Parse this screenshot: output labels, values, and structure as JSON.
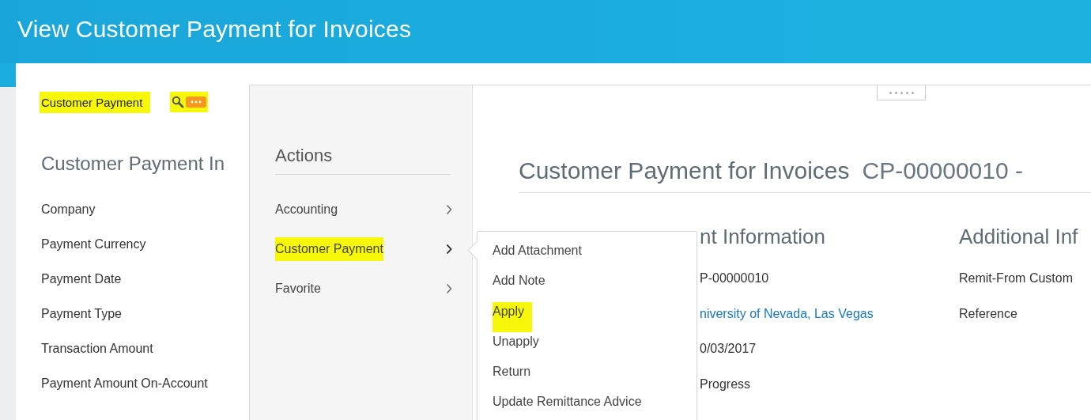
{
  "window": {
    "title": "View Customer Payment for Invoices"
  },
  "left_panel": {
    "header": {
      "text": "Customer Payment",
      "highlighted": true
    },
    "actions_button": {
      "highlighted": true
    },
    "section_title": "Customer Payment In",
    "fields": [
      {
        "label": "Company"
      },
      {
        "label": "Payment Currency"
      },
      {
        "label": "Payment Date"
      },
      {
        "label": "Payment Type"
      },
      {
        "label": "Transaction Amount"
      },
      {
        "label": "Payment Amount On-Account"
      }
    ]
  },
  "actions_menu": {
    "title": "Actions",
    "items": [
      {
        "label": "Accounting",
        "expanded": false,
        "highlighted": false
      },
      {
        "label": "Customer Payment",
        "expanded": true,
        "highlighted": true
      },
      {
        "label": "Favorite",
        "expanded": false,
        "highlighted": false
      }
    ]
  },
  "submenu": {
    "items": [
      {
        "label": "Add Attachment",
        "highlighted": false
      },
      {
        "label": "Add Note",
        "highlighted": false
      },
      {
        "label": "Apply",
        "highlighted": true
      },
      {
        "label": "Unapply",
        "highlighted": false
      },
      {
        "label": "Return",
        "highlighted": false
      },
      {
        "label": "Update Remittance Advice",
        "highlighted": false
      }
    ]
  },
  "main": {
    "title": "Customer Payment for Invoices",
    "reference": "CP-00000010 -",
    "sections": [
      {
        "title": "nt Information",
        "rows": [
          {
            "kind": "text",
            "text": "P-00000010"
          },
          {
            "kind": "link",
            "text": "niversity of Nevada, Las Vegas"
          },
          {
            "kind": "text",
            "text": "0/03/2017"
          },
          {
            "kind": "text",
            "text": "Progress"
          }
        ]
      },
      {
        "title": "Additional Inf",
        "rows": [
          {
            "kind": "label",
            "text": "Remit-From Custom"
          },
          {
            "kind": "label",
            "text": "Reference"
          }
        ]
      }
    ]
  }
}
